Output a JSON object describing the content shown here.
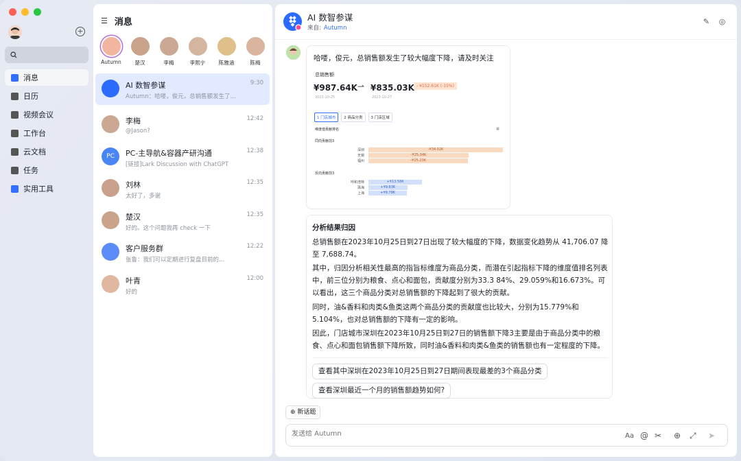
{
  "nav": {
    "items": [
      {
        "label": "消息",
        "color": "#3370ff"
      },
      {
        "label": "日历",
        "color": "#555"
      },
      {
        "label": "视频会议",
        "color": "#555"
      },
      {
        "label": "工作台",
        "color": "#555"
      },
      {
        "label": "云文档",
        "color": "#555"
      },
      {
        "label": "任务",
        "color": "#555"
      },
      {
        "label": "实用工具",
        "color": "#3370ff"
      }
    ]
  },
  "panel": {
    "title": "消息",
    "pinned": [
      {
        "name": "Autumn",
        "color": "#f2b6a0"
      },
      {
        "name": "楚汉",
        "color": "#c9a48a"
      },
      {
        "name": "李梅",
        "color": "#caa893"
      },
      {
        "name": "李熙宁",
        "color": "#d4b59f"
      },
      {
        "name": "陈雅涵",
        "color": "#e0c08a"
      },
      {
        "name": "陈梅",
        "color": "#d9b5a0"
      }
    ],
    "chats": [
      {
        "name": "AI 数智参谋",
        "preview": "Autumn：哈喽，俊元，总销售额发生了...",
        "time": "9:30",
        "color": "#2b6bff"
      },
      {
        "name": "李梅",
        "preview": "@Jason?",
        "time": "12:42",
        "color": "#caa893"
      },
      {
        "name": "PC-主导航&容器产研沟通",
        "preview": "[链接]Lark Discussion with ChatGPT",
        "time": "12:38",
        "color": "#4a85f5",
        "badge": "PC"
      },
      {
        "name": "刘林",
        "preview": "太好了，多谢",
        "time": "12:35",
        "color": "#c7a18b"
      },
      {
        "name": "楚汉",
        "preview": "好的。这个问题我再 check 一下",
        "time": "12:35",
        "color": "#c9a48a"
      },
      {
        "name": "客户服务群",
        "preview": "张鲁：我们可以定期进行复盘目前的...",
        "time": "12:22",
        "color": "#5b8cf7"
      },
      {
        "name": "叶青",
        "preview": "好的",
        "time": "12:00",
        "color": "#e0b8a2"
      }
    ]
  },
  "header": {
    "title": "AI 数智参谋",
    "source_label": "来自:",
    "source_name": "Autumn"
  },
  "card1": {
    "message": "哈喽，俊元，总销售额发生了较大幅度下降，请及时关注",
    "kpi_label": "总销售额",
    "from_value": "¥987.64K",
    "to_value": "¥835.03K",
    "from_date": "2023-10-25",
    "to_date": "2023-10-27",
    "change": "- ¥152.61K (-15%)",
    "tabs": [
      "1 门店城市",
      "2 商品分类",
      "3 门店区域"
    ],
    "section": "维度值贡献排名",
    "neg_title": "同向贡献前3",
    "pos_title": "反向贡献前3",
    "neg_rows": [
      {
        "city": "深圳",
        "label": "-¥34.02K",
        "value": 34.02
      },
      {
        "city": "无锡",
        "label": "-¥25.34K",
        "value": 25.34
      },
      {
        "city": "福州",
        "label": "-¥25.23K",
        "value": 25.23
      }
    ],
    "pos_rows": [
      {
        "city": "呼和浩特",
        "label": "+¥13.56K",
        "value": 13.56
      },
      {
        "city": "珠海",
        "label": "+¥9.83K",
        "value": 9.83
      },
      {
        "city": "上海",
        "label": "+¥9.79K",
        "value": 9.79
      }
    ]
  },
  "card2": {
    "title": "分析结果归因",
    "paragraphs": [
      "总销售额在2023年10月25日到27日出现了较大幅度的下降，数据变化趋势从 41,706.07 降至 7,688.74。",
      "其中，归因分析相关性最高的指旨标维度为商品分类，而潜在引起指标下降的维度值排名列表中，前三位分别为粮食、点心和面包，贡献度分别为33.3 84%、29.059%和16.673%。可以看出，这三个商品分类对总销售额的下降起到了很大的贡献。",
      "同时，油&香料和肉类&鱼类这两个商品分类的贡献度也比较大，分别为15.779%和5.104%，也对总销售额的下降有一定的影响。",
      "因此，门店城市深圳在2023年10月25日到27日的销售额下降3主要是由于商品分类中的粮食、点心和面包销售额下降所致，同时油&香料和肉类&鱼类的销售额也有一定程度的下降。"
    ],
    "suggestions": [
      "查看其中深圳在2023年10月25日到27日期间表现最差的3个商品分类",
      "查看深圳最近一个月的销售额趋势如何?"
    ]
  },
  "composer": {
    "new_topic": "新话题",
    "placeholder": "发送给 Autumn",
    "font_tool": "Aa"
  }
}
